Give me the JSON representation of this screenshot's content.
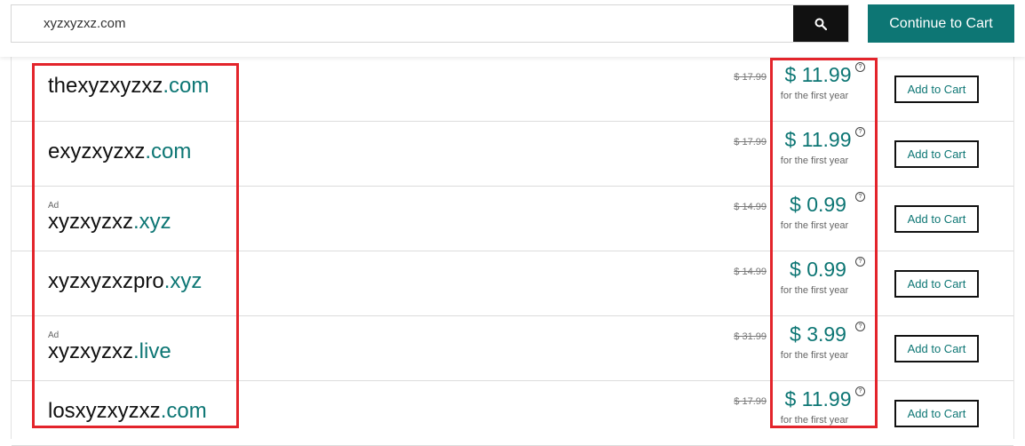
{
  "search": {
    "value": "xyzxyzxz.com",
    "placeholder": ""
  },
  "header": {
    "continue_label": "Continue to Cart"
  },
  "results": [
    {
      "ad": "",
      "name": "thexyzxyzxz",
      "tld": ".com",
      "old_price": "$ 17.99",
      "price": "$ 11.99",
      "note": "for the first year",
      "button": "Add to Cart"
    },
    {
      "ad": "",
      "name": "exyzxyzxz",
      "tld": ".com",
      "old_price": "$ 17.99",
      "price": "$ 11.99",
      "note": "for the first year",
      "button": "Add to Cart"
    },
    {
      "ad": "Ad",
      "name": "xyzxyzxz",
      "tld": ".xyz",
      "old_price": "$ 14.99",
      "price": "$ 0.99",
      "note": "for the first year",
      "button": "Add to Cart"
    },
    {
      "ad": "",
      "name": "xyzxyzxzpro",
      "tld": ".xyz",
      "old_price": "$ 14.99",
      "price": "$ 0.99",
      "note": "for the first year",
      "button": "Add to Cart"
    },
    {
      "ad": "Ad",
      "name": "xyzxyzxz",
      "tld": ".live",
      "old_price": "$ 31.99",
      "price": "$ 3.99",
      "note": "for the first year",
      "button": "Add to Cart"
    },
    {
      "ad": "",
      "name": "losxyzxyzxz",
      "tld": ".com",
      "old_price": "$ 17.99",
      "price": "$ 11.99",
      "note": "for the first year",
      "button": "Add to Cart"
    }
  ],
  "icons": {
    "search": "search-icon",
    "help": "question-circle-icon"
  },
  "colors": {
    "accent": "#0d7674",
    "highlight": "#e3242b",
    "search_button": "#111111"
  }
}
